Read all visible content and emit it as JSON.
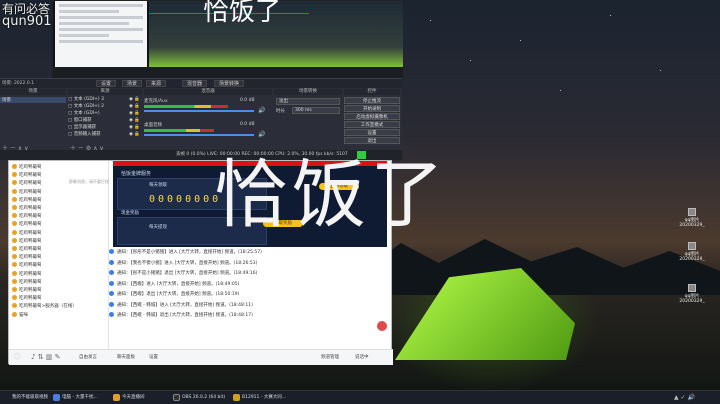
{
  "overlay": {
    "top_left_cn": "有问必答",
    "qun": "qun9014",
    "caption": "恰饭了"
  },
  "obs": {
    "tabs": [
      "设置",
      "场景",
      "来源",
      "混音器",
      "场景转换",
      "控件"
    ],
    "panels": {
      "scenes": "场景",
      "sources": "来源",
      "mixer": "混音器",
      "transitions": "场景转换",
      "controls": "控件"
    },
    "sources": [
      "文本 (GDI+) 3",
      "文本 (GDI+) 2",
      "文本 (GDI+)",
      "窗口捕获",
      "显示器捕获",
      "音频输入捕获"
    ],
    "mixer_tracks": [
      {
        "label": "麦克风/Aux",
        "level": "0.0 dB",
        "level_frac": 0.65
      },
      {
        "label": "桌面音频",
        "level": "0.0 dB",
        "level_frac": 0.55
      }
    ],
    "transition": {
      "name": "淡出",
      "duration_label": "时长",
      "duration": "300 ms"
    },
    "controls": [
      "停止推流",
      "开始录制",
      "启动虚拟摄像机",
      "工作室模式",
      "设置",
      "退出"
    ],
    "status": "丢帧 0 (0.0%)   LIVE: 00:00:00   REC: 00:00:00   CPU: 2.0%, 30.00 fps   kb/s: 5107",
    "window_title": "场景: 2022.0.1"
  },
  "qq": {
    "members": [
      "吃鸡鸭葡萄",
      "吃鸡鸭葡萄",
      "吃鸡鸭葡萄",
      "吃鸡鸭葡萄",
      "吃鸡鸭葡萄",
      "吃鸡鸭葡萄",
      "吃鸡鸭葡萄",
      "吃鸡鸭葡萄",
      "吃鸡鸭葡萄",
      "吃鸡鸭葡萄",
      "吃鸡鸭葡萄",
      "吃鸡鸭葡萄",
      "吃鸡鸭葡萄",
      "吃鸡鸭葡萄",
      "吃鸡鸭葡萄",
      "吃鸡鸭葡萄",
      "吃鸡鸭葡萄",
      "吃鸡鸭葡萄>服务器（在线）",
      "猫咪"
    ],
    "hint": "群聊消息，请不要打扰",
    "ad": {
      "title": "恰饭金牌服务",
      "line1": "每天领取",
      "digits": "00000000",
      "line2": "现金奖励",
      "line3": "每天提现",
      "btn1": "立即领取",
      "btn2": "领取奖励"
    },
    "messages": [
      "通知：【彤彤不是小猪猪】进入 [大厅大转，直接开始] 频道。(18:25:57)",
      "通知：【我也不傻小猪】进入 [大厅大转，直接开始] 频道。(18:26:53)",
      "通知：【彤不是小猪猪】退出 [大厅大转，直接开始] 频道。(18:49:16)",
      "通知：【西峨】进入 [大厅大转，直接开始] 频道。(18:49:05)",
      "通知：【西峨】退出 [大厅大转，直接开始] 频道。(18:50:19)",
      "通知：【西峨 - 韩城】进入 [大厅大转，直接开始] 频道。(18:48:11)",
      "通知：【西峨 - 韩城】退出 [大厅大转，直接开始] 频道。(18:48:17)"
    ],
    "bottom": {
      "mic": "自由发言",
      "apps": "聊天面板",
      "settings": "设置",
      "mode": "频道管理",
      "mic_status": "说话中"
    }
  },
  "desktop_icons": [
    "qq图片",
    "qq图片",
    "qq图片"
  ],
  "desktop_icon_dates": [
    "20200329_",
    "20200329_",
    "20200329_"
  ],
  "taskbar": [
    "我的不能吸取视频",
    "电脑 - 大量干扰...",
    "今天直播间",
    "OBS 26.0.2 (64 bit)",
    "B12911 - 大赛大同..."
  ]
}
